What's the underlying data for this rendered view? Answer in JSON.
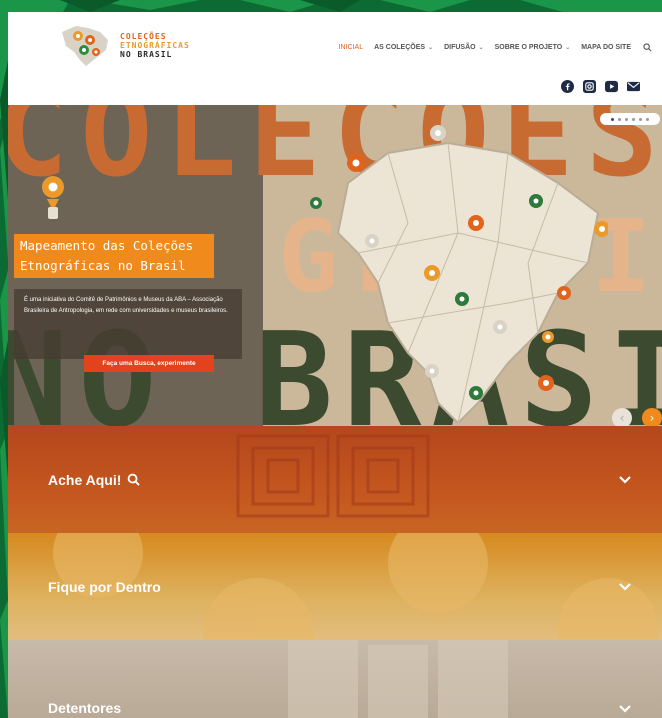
{
  "logo": {
    "line1": "COLEÇÕES",
    "line2": "ETNOGRÁFICAS",
    "line3": "NO BRASIL"
  },
  "nav": {
    "items": [
      {
        "label": "INICIAL",
        "active": true,
        "dropdown": false
      },
      {
        "label": "AS COLEÇÕES",
        "active": false,
        "dropdown": true
      },
      {
        "label": "DIFUSÃO",
        "active": false,
        "dropdown": true
      },
      {
        "label": "SOBRE O PROJETO",
        "active": false,
        "dropdown": true
      },
      {
        "label": "MAPA DO SITE",
        "active": false,
        "dropdown": false
      }
    ],
    "search_icon": "search-icon"
  },
  "social": [
    "facebook-icon",
    "instagram-icon",
    "youtube-icon",
    "email-icon"
  ],
  "hero": {
    "background_letters": {
      "row1": "COLEÇÕES",
      "row2": "GRÁFICAS",
      "row3": "NO BRASIL"
    },
    "title_line1": "Mapeamento das Coleções",
    "title_line2": "Etnográficas no Brasil",
    "description": "É uma iniciativa do Comitê de Patrimônios e Museus da ABA – Associação Brasileira de Antropologia, em rede com universidades e museus brasileiros.",
    "cta_label": "Faça uma Busca, experimente",
    "slide_count": 6,
    "active_slide": 1,
    "prev_label": "‹",
    "next_label": "›"
  },
  "accordions": [
    {
      "label": "Ache Aqui!",
      "icon": "search-icon"
    },
    {
      "label": "Fique por Dentro",
      "icon": ""
    },
    {
      "label": "Detentores",
      "icon": ""
    }
  ],
  "colors": {
    "accent": "#e2631c",
    "orange": "#f08a1c",
    "cta": "#e2431c",
    "green": "#0e7a3a"
  }
}
